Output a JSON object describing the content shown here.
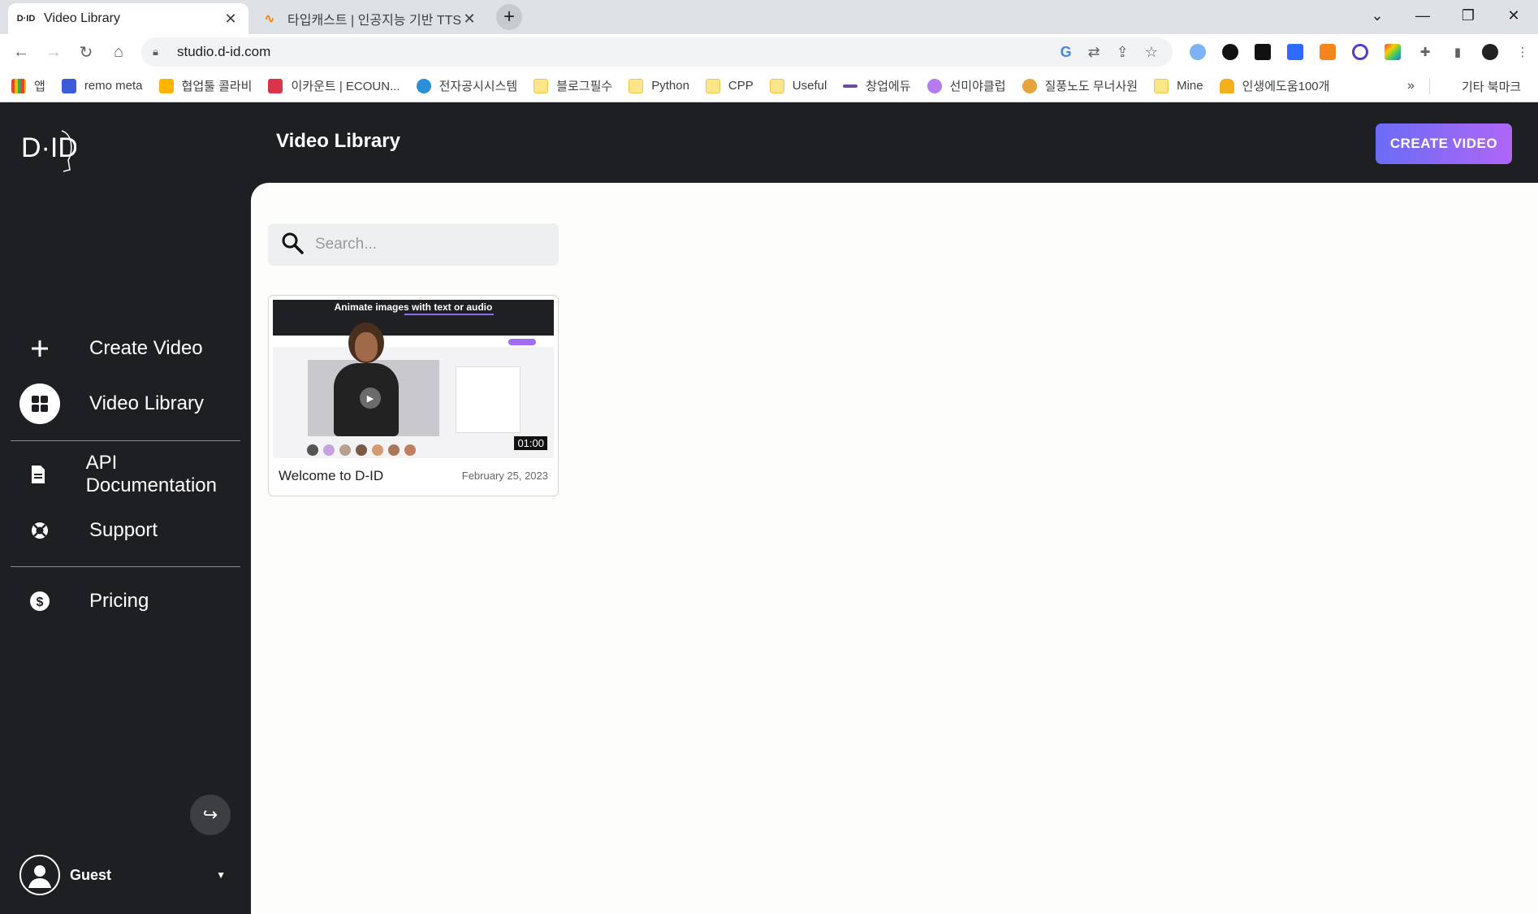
{
  "browser": {
    "tabs": [
      {
        "title": "Video Library",
        "favicon": "D-ID"
      },
      {
        "title": "타입캐스트 | 인공지능 기반 TTS",
        "favicon": "typecast"
      }
    ],
    "url": "studio.d-id.com",
    "bookmarks": [
      {
        "label": "앱",
        "icon": "apps-grid-icon"
      },
      {
        "label": "remo meta",
        "icon": "remo-icon"
      },
      {
        "label": "협업툴 콜라비",
        "icon": "collabee-icon"
      },
      {
        "label": "이카운트 | ECOUN...",
        "icon": "ecount-icon"
      },
      {
        "label": "전자공시시스템",
        "icon": "dart-icon"
      },
      {
        "label": "블로그필수",
        "icon": "folder-icon"
      },
      {
        "label": "Python",
        "icon": "folder-icon"
      },
      {
        "label": "CPP",
        "icon": "folder-icon"
      },
      {
        "label": "Useful",
        "icon": "folder-icon"
      },
      {
        "label": "창업에듀",
        "icon": "startup-icon"
      },
      {
        "label": "선미야클럽",
        "icon": "club-icon"
      },
      {
        "label": "질풍노도 무너사원",
        "icon": "person-icon"
      },
      {
        "label": "Mine",
        "icon": "folder-icon"
      },
      {
        "label": "인생에도움100개",
        "icon": "trophy-icon"
      }
    ],
    "bookmarks_more": "»",
    "other_bookmarks": "기타 북마크"
  },
  "app": {
    "header_title": "Video Library",
    "create_button": "CREATE VIDEO",
    "sidebar": {
      "items": [
        {
          "label": "Create Video",
          "icon": "plus-icon"
        },
        {
          "label": "Video Library",
          "icon": "grid-icon",
          "active": true
        },
        {
          "label": "API Documentation",
          "icon": "document-icon"
        },
        {
          "label": "Support",
          "icon": "lifebuoy-icon"
        },
        {
          "label": "Pricing",
          "icon": "dollar-icon"
        }
      ],
      "user": {
        "name": "Guest"
      }
    },
    "search": {
      "placeholder": "Search..."
    },
    "videos": [
      {
        "title": "Welcome to D-ID",
        "date": "February 25, 2023",
        "duration": "01:00",
        "thumbnail_headline": "Animate images with text or audio"
      }
    ]
  },
  "colors": {
    "app_bg": "#1e1f22",
    "content_bg": "#fdfdfc",
    "accent_start": "#6a6cf6",
    "accent_end": "#b066f7"
  }
}
